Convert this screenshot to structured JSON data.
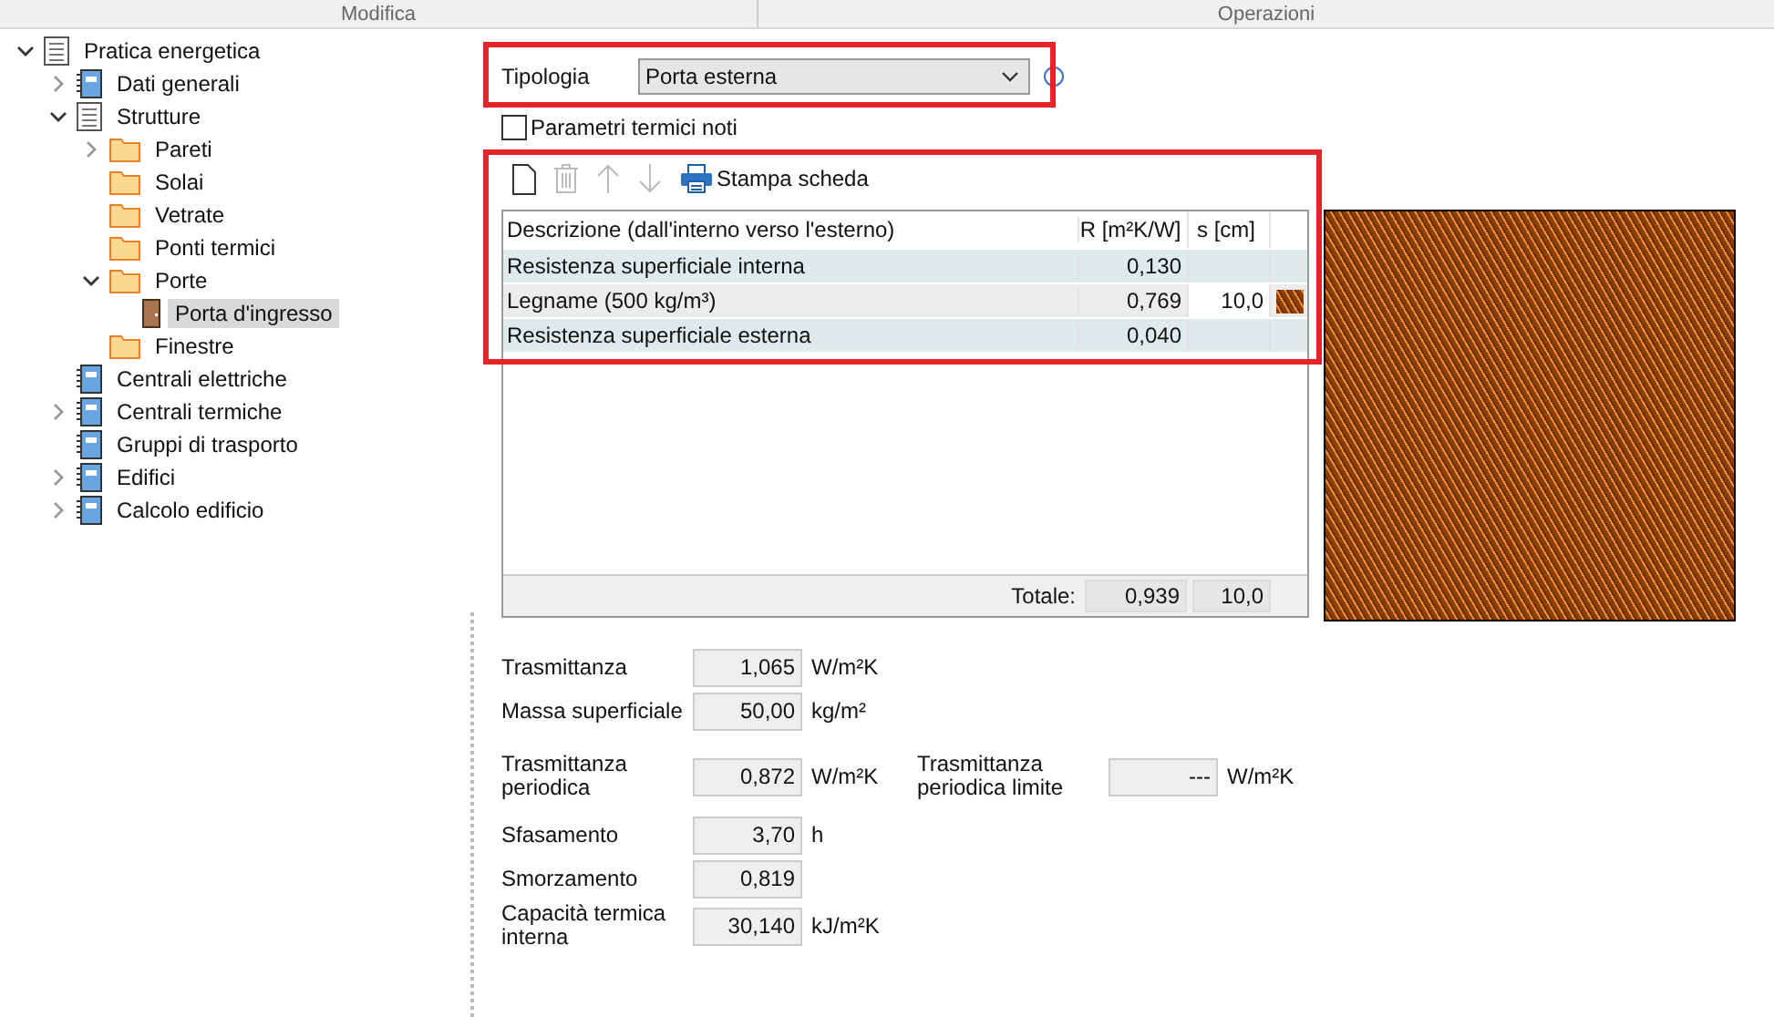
{
  "header": {
    "left": "Modifica",
    "right": "Operazioni"
  },
  "tree": [
    {
      "label": "Pratica energetica",
      "kind": "document",
      "expanded": true,
      "selected": false,
      "children": [
        {
          "label": "Dati generali",
          "kind": "module",
          "expanded": false,
          "selected": false
        },
        {
          "label": "Strutture",
          "kind": "document",
          "expanded": true,
          "selected": false,
          "children": [
            {
              "label": "Pareti",
              "kind": "folder",
              "expanded": false,
              "selected": false
            },
            {
              "label": "Solai",
              "kind": "folder",
              "selected": false
            },
            {
              "label": "Vetrate",
              "kind": "folder",
              "selected": false
            },
            {
              "label": "Ponti termici",
              "kind": "folder",
              "selected": false
            },
            {
              "label": "Porte",
              "kind": "folder",
              "expanded": true,
              "selected": false,
              "children": [
                {
                  "label": "Porta d'ingresso",
                  "kind": "door",
                  "selected": true
                }
              ]
            },
            {
              "label": "Finestre",
              "kind": "folder",
              "selected": false
            }
          ]
        },
        {
          "label": "Centrali elettriche",
          "kind": "module",
          "selected": false
        },
        {
          "label": "Centrali termiche",
          "kind": "module",
          "expanded": false,
          "selected": false
        },
        {
          "label": "Gruppi di trasporto",
          "kind": "module",
          "selected": false
        },
        {
          "label": "Edifici",
          "kind": "module",
          "expanded": false,
          "selected": false
        },
        {
          "label": "Calcolo edificio",
          "kind": "module",
          "expanded": false,
          "selected": false
        }
      ]
    }
  ],
  "tipologia": {
    "label": "Tipologia",
    "value": "Porta esterna"
  },
  "known_params": {
    "label": "Parametri termici noti",
    "checked": false
  },
  "toolbar": [
    {
      "kind": "new",
      "disabled": false
    },
    {
      "kind": "delete",
      "disabled": true
    },
    {
      "kind": "up",
      "disabled": true
    },
    {
      "kind": "down",
      "disabled": true
    },
    {
      "kind": "print",
      "label": "Stampa scheda",
      "disabled": false
    }
  ],
  "layers": {
    "columns": [
      "Descrizione (dall'interno verso l'esterno)",
      "R [m²K/W]",
      "s [cm]"
    ],
    "rows": [
      {
        "kind": "surface",
        "description": "Resistenza superficiale interna",
        "r": "0,130"
      },
      {
        "kind": "material",
        "description": "Legname (500 kg/m³)",
        "r": "0,769",
        "s": "10,0"
      },
      {
        "kind": "surface",
        "description": "Resistenza superficiale esterna",
        "r": "0,040"
      }
    ],
    "total_label": "Totale:",
    "total_r": "0,939",
    "total_s": "10,0"
  },
  "results": [
    {
      "fields": [
        {
          "label": "Trasmittanza",
          "value": "1,065",
          "unit": "W/m²K"
        }
      ]
    },
    {
      "fields": [
        {
          "label": "Massa superficiale",
          "value": "50,00",
          "unit": "kg/m²"
        }
      ]
    },
    {
      "fields": [
        {
          "label": "Trasmittanza periodica",
          "value": "0,872",
          "unit": "W/m²K"
        },
        {
          "label": "Trasmittanza periodica limite",
          "value": "---",
          "unit": "W/m²K"
        }
      ]
    },
    {
      "fields": [
        {
          "label": "Sfasamento",
          "value": "3,70",
          "unit": "h"
        }
      ]
    },
    {
      "fields": [
        {
          "label": "Smorzamento",
          "value": "0,819"
        }
      ]
    },
    {
      "fields": [
        {
          "label": "Capacità termica interna",
          "value": "30,140",
          "unit": "kJ/m²K"
        }
      ]
    }
  ]
}
